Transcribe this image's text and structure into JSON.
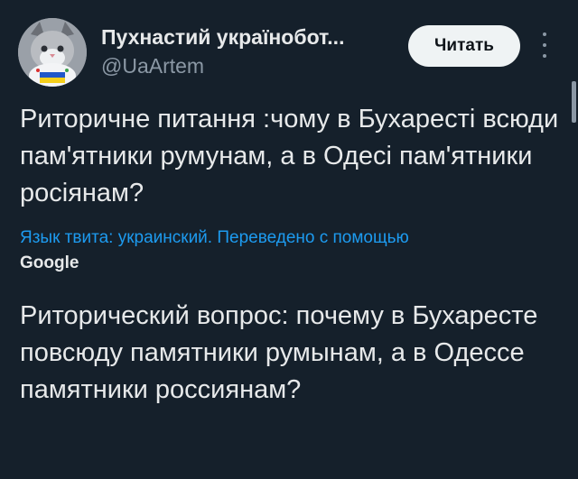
{
  "author": {
    "display_name": "Пухнастий українобот...",
    "handle": "@UaArtem",
    "avatar": "cat-avatar-with-flag"
  },
  "actions": {
    "follow_label": "Читать",
    "more_icon": "vertical-ellipsis-icon"
  },
  "tweet": {
    "text": "Риторичне питання :чому в Бухаресті всюди пам'ятники румунам, а в Одесі пам'ятники росіянам?",
    "translation_note": "Язык твита: украинский. Переведено с помощью",
    "translation_provider": "Google",
    "translated_text": "Риторический вопрос: почему в Бухаресте повсюду памятники румынам, а в Одессе памятники россиянам?"
  },
  "colors": {
    "background": "#15202b",
    "text": "#e7e9ea",
    "secondary": "#8b98a5",
    "link": "#1d9bf0",
    "button_bg": "#eff3f4"
  }
}
